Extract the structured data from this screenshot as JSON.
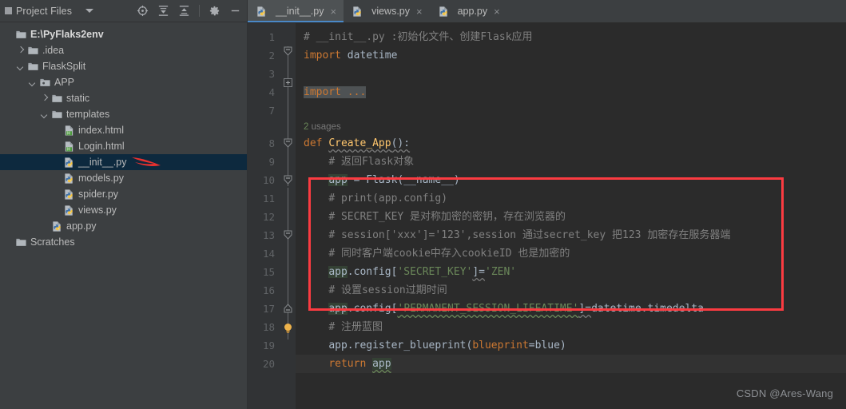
{
  "window": {
    "watermark": "CSDN @Ares-Wang"
  },
  "sidebar": {
    "panel_title": "Project Files",
    "tools": [
      {
        "name": "locate-icon",
        "title": "Select Opened File"
      },
      {
        "name": "expand-all-icon",
        "title": "Expand All"
      },
      {
        "name": "collapse-all-icon",
        "title": "Collapse All"
      },
      {
        "name": "gear-icon",
        "title": "Settings"
      },
      {
        "name": "minimize-icon",
        "title": "Hide"
      }
    ],
    "tree": [
      {
        "label": "E:\\PyFlaks2env",
        "indent": 0,
        "arrow": "none",
        "icon": "folder-icon",
        "selected": false,
        "root": true
      },
      {
        "label": ".idea",
        "indent": 1,
        "arrow": "right",
        "icon": "folder-icon",
        "selected": false,
        "root": false
      },
      {
        "label": "FlaskSplit",
        "indent": 1,
        "arrow": "down",
        "icon": "folder-icon",
        "selected": false,
        "root": false
      },
      {
        "label": "APP",
        "indent": 2,
        "arrow": "down",
        "icon": "module-folder-icon",
        "selected": false,
        "root": false
      },
      {
        "label": "static",
        "indent": 3,
        "arrow": "right",
        "icon": "folder-icon",
        "selected": false,
        "root": false
      },
      {
        "label": "templates",
        "indent": 3,
        "arrow": "down",
        "icon": "folder-icon",
        "selected": false,
        "root": false
      },
      {
        "label": "index.html",
        "indent": 4,
        "arrow": "none",
        "icon": "html-file-icon",
        "selected": false,
        "root": false
      },
      {
        "label": "Login.html",
        "indent": 4,
        "arrow": "none",
        "icon": "html-file-icon",
        "selected": false,
        "root": false
      },
      {
        "label": "__init__.py",
        "indent": 4,
        "arrow": "none",
        "icon": "python-file-icon",
        "selected": true,
        "root": false
      },
      {
        "label": "models.py",
        "indent": 4,
        "arrow": "none",
        "icon": "python-file-icon",
        "selected": false,
        "root": false
      },
      {
        "label": "spider.py",
        "indent": 4,
        "arrow": "none",
        "icon": "python-file-icon",
        "selected": false,
        "root": false
      },
      {
        "label": "views.py",
        "indent": 4,
        "arrow": "none",
        "icon": "python-file-icon",
        "selected": false,
        "root": false
      },
      {
        "label": "app.py",
        "indent": 3,
        "arrow": "none",
        "icon": "python-file-icon",
        "selected": false,
        "root": false
      },
      {
        "label": "Scratches",
        "indent": 0,
        "arrow": "none",
        "icon": "folder-icon",
        "selected": false,
        "root": false
      }
    ]
  },
  "editor": {
    "tabs": [
      {
        "label": "__init__.py",
        "icon": "python-file-icon",
        "active": true,
        "close": "×"
      },
      {
        "label": "views.py",
        "icon": "python-file-icon",
        "active": false,
        "close": "×"
      },
      {
        "label": "app.py",
        "icon": "python-file-icon",
        "active": false,
        "close": "×"
      }
    ],
    "line_numbers": [
      "1",
      "2",
      "3",
      "4",
      "7",
      "8",
      "9",
      "10",
      "11",
      "12",
      "13",
      "14",
      "15",
      "16",
      "17",
      "18",
      "19",
      "20"
    ],
    "inlay_hint": {
      "count": "2",
      "text": "usages"
    },
    "code_lines": [
      "# __init__.py :初始化文件、创建Flask应用",
      "import datetime",
      "",
      "import ...",
      "",
      "def Create_App():",
      "    # 返回Flask对象",
      "    app = Flask(__name__)",
      "    # print(app.config)",
      "    # SECRET_KEY 是对称加密的密钥，存在浏览器的",
      "    # session['xxx']='123',session 通过secret_key 把123 加密存在服务器端",
      "    # 同时客户端cookie中存入cookieID 也是加密的",
      "    app.config['SECRET_KEY']='ZEN'",
      "    # 设置session过期时间",
      "    app.config['PERMANENT_SESSION_LIFEATIME']=datetime.timedelta",
      "    # 注册蓝图",
      "    app.register_blueprint(blueprint=blue)",
      "    return app"
    ],
    "tokens": {
      "l1_comment": "# __init__.py :初始化文件、创建Flask应用",
      "l2_kw": "import",
      "l2_mod": "datetime",
      "l4_fold": "import ...",
      "l8_kw": "def",
      "l8_name": "Create_App",
      "l8_tail": "():",
      "l9_comment": "# 返回Flask对象",
      "l10_var": "app",
      "l10_eq": " = ",
      "l10_call": "Flask(__name__)",
      "l11_comment": "# print(app.config)",
      "l12_comment": "# SECRET_KEY 是对称加密的密钥，存在浏览器的",
      "l13_comment": "# session['xxx']='123',session 通过secret_key 把123 加密存在服务器端",
      "l14_comment": "# 同时客户端cookie中存入cookieID 也是加密的",
      "l15_var": "app",
      "l15_mid": ".config[",
      "l15_key": "'SECRET_KEY'",
      "l15_eq": "]=",
      "l15_val": "'ZEN'",
      "l16_comment": "# 设置session过期时间",
      "l17_var": "app",
      "l17_mid": ".config[",
      "l17_key": "'PERMANENT_SESSION_LIFEATIME'",
      "l17_eq": "]=",
      "l17_val": "datetime.timedelta",
      "l18_comment": "# 注册蓝图",
      "l19_obj": "app.register_blueprint(",
      "l19_param": "blueprint",
      "l19_eq": "=",
      "l19_arg": "blue",
      "l19_end": ")",
      "l20_kw": "return",
      "l20_var": "app"
    }
  },
  "annotations": {
    "red_box": {
      "name": "red-highlight-rectangle",
      "color": "#fb3b41"
    },
    "red_arrow": {
      "name": "red-pointer-arrow",
      "color": "#e8312f"
    }
  }
}
